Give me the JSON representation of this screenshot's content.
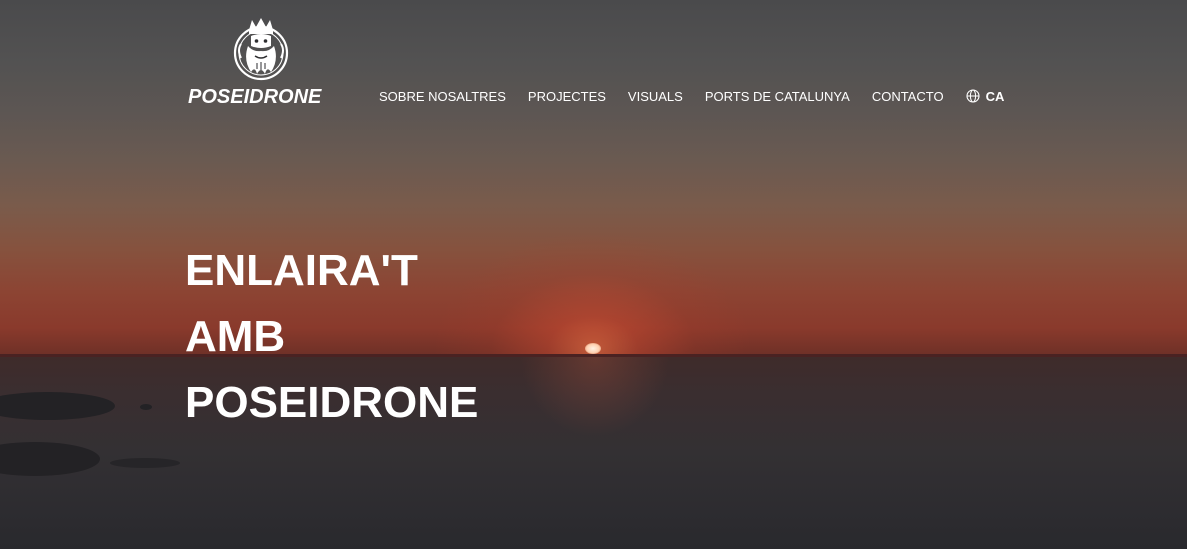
{
  "brand": {
    "name": "POSEIDRONE",
    "logo_icon": "poseidon-head-icon"
  },
  "nav": {
    "items": [
      {
        "label": "SOBRE NOSALTRES"
      },
      {
        "label": "PROJECTES"
      },
      {
        "label": "VISUALS"
      },
      {
        "label": "PORTS DE CATALUNYA"
      },
      {
        "label": "CONTACTO"
      }
    ],
    "language": {
      "icon": "globe-icon",
      "code": "CA"
    }
  },
  "hero": {
    "headline_lines": [
      "ENLAIRA'T",
      "AMB",
      "POSEIDRONE"
    ],
    "background": "sunset-over-sea",
    "colors": {
      "text": "#ffffff",
      "sky_top": "#4a4a4c",
      "sunset": "#8c4433",
      "sea": "#2d2c30"
    }
  }
}
